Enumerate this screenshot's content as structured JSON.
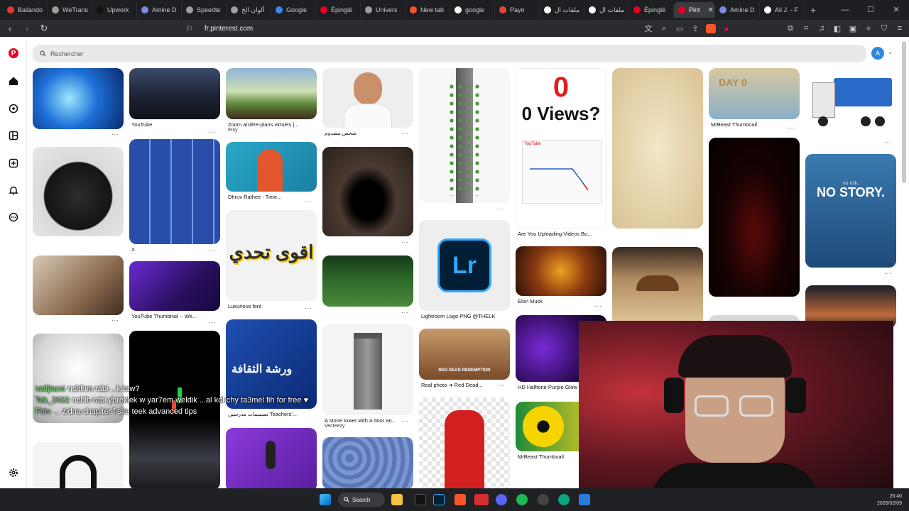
{
  "tabs": [
    {
      "label": "Bailando",
      "color": "#e53935"
    },
    {
      "label": "WeTrans",
      "color": "#9e9e9e"
    },
    {
      "label": "Upwork",
      "color": "#111111"
    },
    {
      "label": "Amine D",
      "color": "#7b8cde"
    },
    {
      "label": "Speedte",
      "color": "#9e9e9e"
    },
    {
      "label": "ألوان الخ",
      "color": "#9e9e9e"
    },
    {
      "label": "Google",
      "color": "#4285f4"
    },
    {
      "label": "Épinglé",
      "color": "#e60023"
    },
    {
      "label": "Univers",
      "color": "#9e9e9e"
    },
    {
      "label": "New tab",
      "color": "#fb542b"
    },
    {
      "label": "google",
      "color": "#ffffff"
    },
    {
      "label": "Payo",
      "color": "#ea4335"
    },
    {
      "label": "ملفات ال",
      "color": "#ffffff"
    },
    {
      "label": "ملفات ال",
      "color": "#ffffff"
    },
    {
      "label": "Épinglé",
      "color": "#e60023"
    },
    {
      "label": "Pint",
      "color": "#e60023",
      "active": true
    },
    {
      "label": "Amine D",
      "color": "#7b8cde"
    },
    {
      "label": "Ali J. - F",
      "color": "#ffffff"
    }
  ],
  "address": {
    "url": "fr.pinterest.com"
  },
  "search": {
    "placeholder": "Rechercher"
  },
  "profile": {
    "initial": "A"
  },
  "sidebar": {
    "icons": [
      "pinterest-logo",
      "home-icon",
      "explore-icon",
      "boards-icon",
      "create-icon",
      "notifications-icon",
      "messages-icon",
      "settings-icon"
    ]
  },
  "pins": {
    "c1": [
      {
        "caption": ""
      },
      {
        "caption": ""
      },
      {
        "caption": ""
      },
      {
        "caption": ""
      },
      {
        "caption": ""
      }
    ],
    "c2": [
      {
        "caption": "YouTube"
      },
      {
        "caption": "X"
      },
      {
        "caption": "YouTube Thumbnail – We..."
      },
      {
        "caption": ""
      }
    ],
    "c3": [
      {
        "caption": "Zoom arrière-plans virtuels |...",
        "sub": "Etsy"
      },
      {
        "caption": "Dhruv Rathee - Time..."
      },
      {
        "caption": "Luxurious font",
        "overlay": "اقوى تحدي"
      },
      {
        "caption": "تصميمات مدرسين Teachers'...",
        "overlay": "ورشة الثقافة"
      },
      {
        "caption": ""
      }
    ],
    "c4": [
      {
        "caption": "شخص مصدوم"
      },
      {
        "caption": ""
      },
      {
        "caption": ""
      },
      {
        "caption": "A stone tower with a door an...",
        "sub": "Vecteezy"
      },
      {
        "caption": ""
      }
    ],
    "c5": [
      {
        "caption": ""
      },
      {
        "caption": "Lightroom Logo PNG @THELK",
        "overlay": "Lr"
      },
      {
        "caption": "Real photo ➜ Red Dead...",
        "overlay": "RED DEAD REDEMPTION"
      },
      {
        "caption": ""
      }
    ],
    "c6": [
      {
        "caption": "Are You Uploading Videos Bu...",
        "overlay": "0 Views?",
        "badge": "YouTube"
      },
      {
        "caption": "Elon Musk"
      },
      {
        "caption": "HD Halftone Purple Glow"
      },
      {
        "caption": "MrBeast Thumbnail"
      }
    ],
    "c7": [
      {
        "caption": ""
      },
      {
        "caption": ""
      }
    ],
    "c8": [
      {
        "caption": "MrBeast Thumbnail",
        "overlay": "DAY 0"
      },
      {
        "caption": ""
      },
      {
        "caption": ""
      }
    ],
    "c9": [
      {
        "caption": ""
      },
      {
        "caption": "",
        "overlay": "NO STORY.",
        "small": "no risk,"
      },
      {
        "caption": ""
      }
    ]
  },
  "chat": [
    {
      "name": "saifjlassi",
      "text": "nchlhm rabi ...k taw?"
    },
    {
      "name": "Tak_2022",
      "text": "nchlh rabi ybreklek w yar7em weldik ...al kol chy ta3mel fih for free ♥"
    },
    {
      "name": "Fbtv",
      "text": "... zidna chapiter f site teek advanced tips"
    }
  ],
  "taskbar": {
    "search_label": "Search",
    "time": "20:40",
    "date": "2026/02/09"
  }
}
